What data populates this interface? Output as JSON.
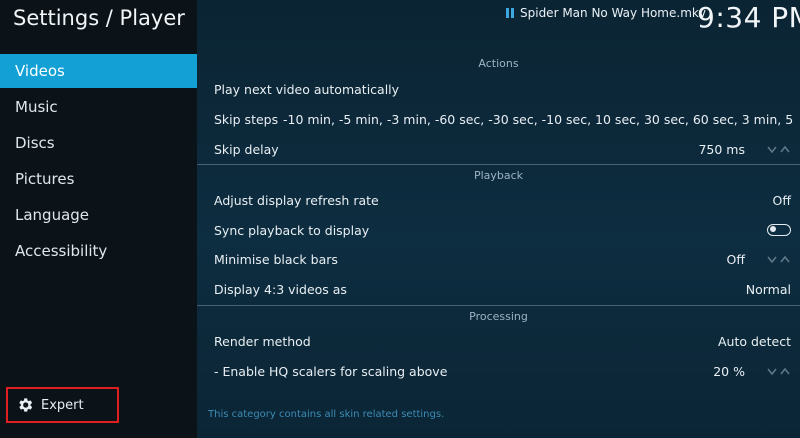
{
  "header": {
    "title": "Settings / Player",
    "now_playing": "Spider Man No Way Home.mkv",
    "clock": "9:34 PM"
  },
  "sidebar": {
    "items": [
      {
        "label": "Videos",
        "active": true
      },
      {
        "label": "Music",
        "active": false
      },
      {
        "label": "Discs",
        "active": false
      },
      {
        "label": "Pictures",
        "active": false
      },
      {
        "label": "Language",
        "active": false
      },
      {
        "label": "Accessibility",
        "active": false
      }
    ],
    "level_button": {
      "label": "Expert",
      "icon": "gear-icon"
    }
  },
  "sections": {
    "actions": {
      "title": "Actions",
      "play_next": {
        "label": "Play next video automatically"
      },
      "skip_steps": {
        "label": "Skip steps",
        "value": "-10 min, -5 min, -3 min, -60 sec, -30 sec, -10 sec, 10 sec, 30 sec, 60 sec, 3 min, 5 min,..."
      },
      "skip_delay": {
        "label": "Skip delay",
        "value": "750 ms"
      }
    },
    "playback": {
      "title": "Playback",
      "refresh_rate": {
        "label": "Adjust display refresh rate",
        "value": "Off"
      },
      "sync_playback": {
        "label": "Sync playback to display",
        "enabled": false
      },
      "black_bars": {
        "label": "Minimise black bars",
        "value": "Off"
      },
      "display_43": {
        "label": "Display 4:3 videos as",
        "value": "Normal"
      }
    },
    "processing": {
      "title": "Processing",
      "render_method": {
        "label": "Render method",
        "value": "Auto detect"
      },
      "hq_scalers": {
        "label": "- Enable HQ scalers for scaling above",
        "value": "20 %"
      }
    }
  },
  "hint": "This category contains all skin related settings.",
  "colors": {
    "accent": "#12a0d5",
    "highlight_border": "#e02020"
  }
}
